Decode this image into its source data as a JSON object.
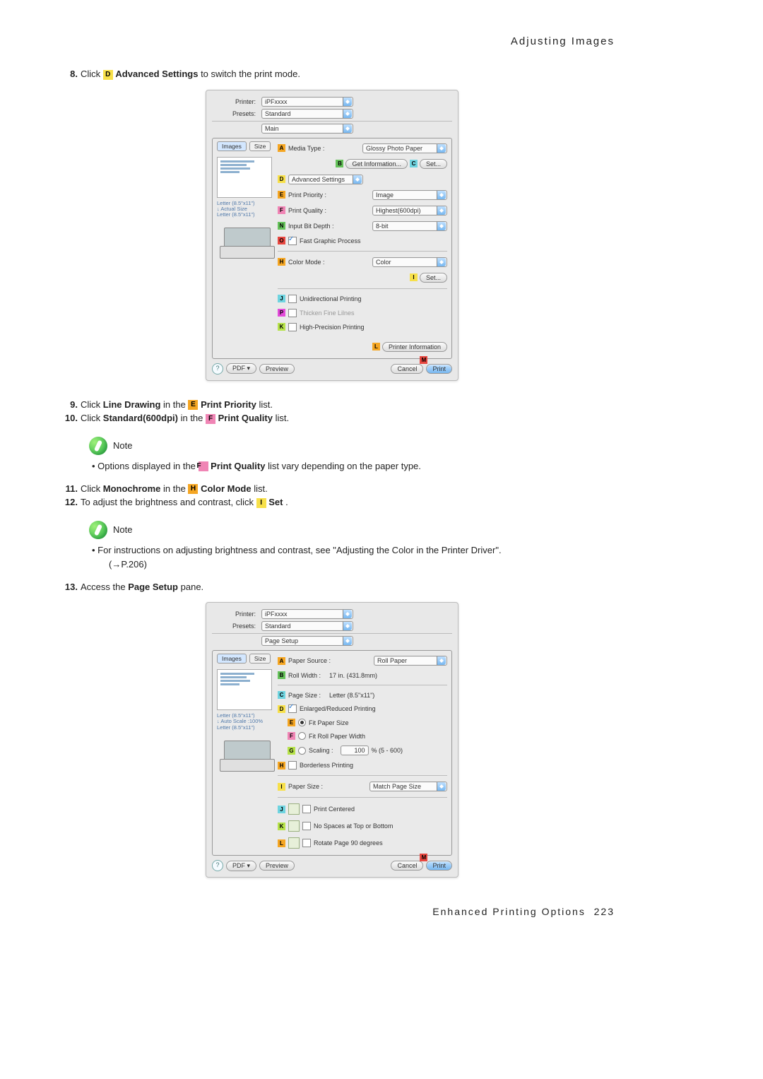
{
  "header": {
    "title": "Adjusting Images"
  },
  "steps": {
    "s8": {
      "num": "8.",
      "t1": " Click ",
      "m": "D",
      "b": " Advanced Settings",
      "t2": " to switch the print mode."
    },
    "s9": {
      "num": "9.",
      "t1": "Click ",
      "b1": "Line Drawing",
      "t2": " in the ",
      "m": "E",
      "b2": " Print Priority",
      "t3": " list."
    },
    "s10": {
      "num": "10.",
      "t1": "Click ",
      "b1": "Standard(600dpi)",
      "t2": " in the ",
      "m": "F",
      "b2": " Print Quality",
      "t3": " list."
    },
    "s11": {
      "num": "11.",
      "t1": "Click ",
      "b1": "Monochrome",
      "t2": " in the ",
      "m": "H",
      "b2": " Color Mode",
      "t3": " list."
    },
    "s12": {
      "num": "12.",
      "t1": "To adjust the brightness and contrast, click ",
      "m": "I",
      "b": " Set",
      "t2": "."
    },
    "s13": {
      "num": "13.",
      "t1": "Access the ",
      "b": "Page Setup",
      "t2": " pane."
    }
  },
  "note1": {
    "title": "Note",
    "bullet_prefix": "•  Options displayed in the ",
    "marker": "F",
    "bold": " Print Quality",
    "suffix": " list vary depending on the paper type."
  },
  "note2": {
    "title": "Note",
    "line1": "•  For instructions on adjusting brightness and contrast, see \"Adjusting the Color in the Printer Driver\".",
    "line2": "(→P.206)"
  },
  "dialog1": {
    "printer_label": "Printer:",
    "printer_value": "iPFxxxx",
    "presets_label": "Presets:",
    "presets_value": "Standard",
    "pane_value": "Main",
    "tab_images": "Images",
    "tab_size": "Size",
    "preview_line1": "Letter (8.5\"x11\")",
    "preview_line2": "↓ Actual Size",
    "preview_line3": "Letter (8.5\"x11\")",
    "rows": {
      "A": {
        "label": "Media Type :",
        "value": "Glossy Photo Paper"
      },
      "B": {
        "btn": "Get Information..."
      },
      "C": {
        "btn": "Set..."
      },
      "D": {
        "label": "Advanced Settings",
        "value": ""
      },
      "E": {
        "label": "Print Priority :",
        "value": "Image"
      },
      "F": {
        "label": "Print Quality :",
        "value": "Highest(600dpi)"
      },
      "N": {
        "label": "Input Bit Depth :",
        "value": "8-bit"
      },
      "O": {
        "label": "Fast Graphic Process"
      },
      "H": {
        "label": "Color Mode :",
        "value": "Color"
      },
      "I": {
        "btn": "Set..."
      },
      "J": {
        "label": "Unidirectional Printing"
      },
      "P": {
        "label": "Thicken Fine Lilnes"
      },
      "K": {
        "label": "High-Precision Printing"
      },
      "L": {
        "btn": "Printer Information"
      },
      "M": {}
    },
    "footer": {
      "help": "?",
      "pdf": "PDF ▾",
      "preview": "Preview",
      "cancel": "Cancel",
      "print": "Print"
    }
  },
  "dialog2": {
    "printer_label": "Printer:",
    "printer_value": "iPFxxxx",
    "presets_label": "Presets:",
    "presets_value": "Standard",
    "pane_value": "Page Setup",
    "tab_images": "Images",
    "tab_size": "Size",
    "preview_line1": "Letter (8.5\"x11\")",
    "preview_line2": "↓ Auto Scale :100%",
    "preview_line3": "Letter (8.5\"x11\")",
    "rows": {
      "A": {
        "label": "Paper Source :",
        "value": "Roll Paper"
      },
      "B": {
        "label": "Roll Width :",
        "value": "17 in. (431.8mm)"
      },
      "C": {
        "label": "Page Size :",
        "value": "Letter (8.5\"x11\")"
      },
      "D": {
        "label": "Enlarged/Reduced Printing"
      },
      "E": {
        "label": "Fit Paper Size"
      },
      "F": {
        "label": "Fit Roll Paper Width"
      },
      "G": {
        "label": "Scaling :",
        "value": "100",
        "suffix": "% (5 - 600)"
      },
      "H": {
        "label": "Borderless Printing"
      },
      "I": {
        "label": "Paper Size :",
        "value": "Match Page Size"
      },
      "J": {
        "label": "Print Centered"
      },
      "K": {
        "label": "No Spaces at Top or Bottom"
      },
      "L": {
        "label": "Rotate Page 90 degrees"
      },
      "M": {}
    },
    "footer": {
      "help": "?",
      "pdf": "PDF ▾",
      "preview": "Preview",
      "cancel": "Cancel",
      "print": "Print"
    }
  },
  "footer": {
    "text": "Enhanced Printing Options",
    "page": "223"
  }
}
